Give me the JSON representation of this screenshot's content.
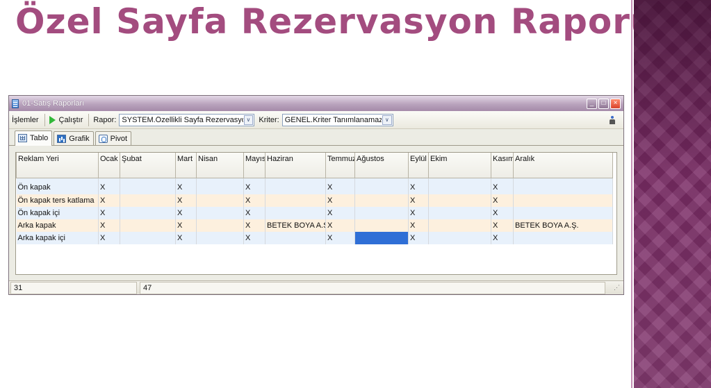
{
  "slide": {
    "title": "Özel Sayfa Rezervasyon Raporu"
  },
  "window": {
    "title": "01-Satış Raporları",
    "controls": {
      "minimize": "_",
      "maximize": "□",
      "close": "×"
    }
  },
  "toolbar": {
    "islemler_label": "İşlemler",
    "calistir_label": "Çalıştır",
    "rapor_label": "Rapor:",
    "rapor_value": "SYSTEM.Özellikli Sayfa Rezervasyonları",
    "kriter_label": "Kriter:",
    "kriter_value": "GENEL.Kriter Tanımlanamaz",
    "dropdown_arrow": "∨"
  },
  "tabs": [
    {
      "label": "Tablo",
      "icon": "table-icon",
      "active": true
    },
    {
      "label": "Grafik",
      "icon": "chart-icon",
      "active": false
    },
    {
      "label": "Pivot",
      "icon": "pivot-icon",
      "active": false
    }
  ],
  "table": {
    "columns": [
      "Reklam Yeri",
      "Ocak",
      "Şubat",
      "Mart",
      "Nisan",
      "Mayıs",
      "Haziran",
      "Temmuz",
      "Ağustos",
      "Eylül",
      "Ekim",
      "Kasım",
      "Aralık"
    ],
    "rows": [
      [
        "Ön kapak",
        "X",
        "",
        "X",
        "",
        "X",
        "",
        "X",
        "",
        "X",
        "",
        "X",
        ""
      ],
      [
        "Ön kapak  ters katlama",
        "X",
        "",
        "X",
        "",
        "X",
        "",
        "X",
        "",
        "X",
        "",
        "X",
        ""
      ],
      [
        "Ön kapak içi",
        "X",
        "",
        "X",
        "",
        "X",
        "",
        "X",
        "",
        "X",
        "",
        "X",
        ""
      ],
      [
        "Arka kapak",
        "X",
        "",
        "X",
        "",
        "X",
        "BETEK BOYA A.Ş.",
        "X",
        "",
        "X",
        "",
        "X",
        "BETEK BOYA A.Ş."
      ],
      [
        "Arka kapak içi",
        "X",
        "",
        "X",
        "",
        "X",
        "",
        "X",
        "",
        "X",
        "",
        "X",
        ""
      ]
    ]
  },
  "status": {
    "left": "31",
    "right": "47"
  },
  "colors": {
    "title": "#a34c7f",
    "band": "#7b2c66",
    "selected_cell": "#2f6fd6"
  }
}
